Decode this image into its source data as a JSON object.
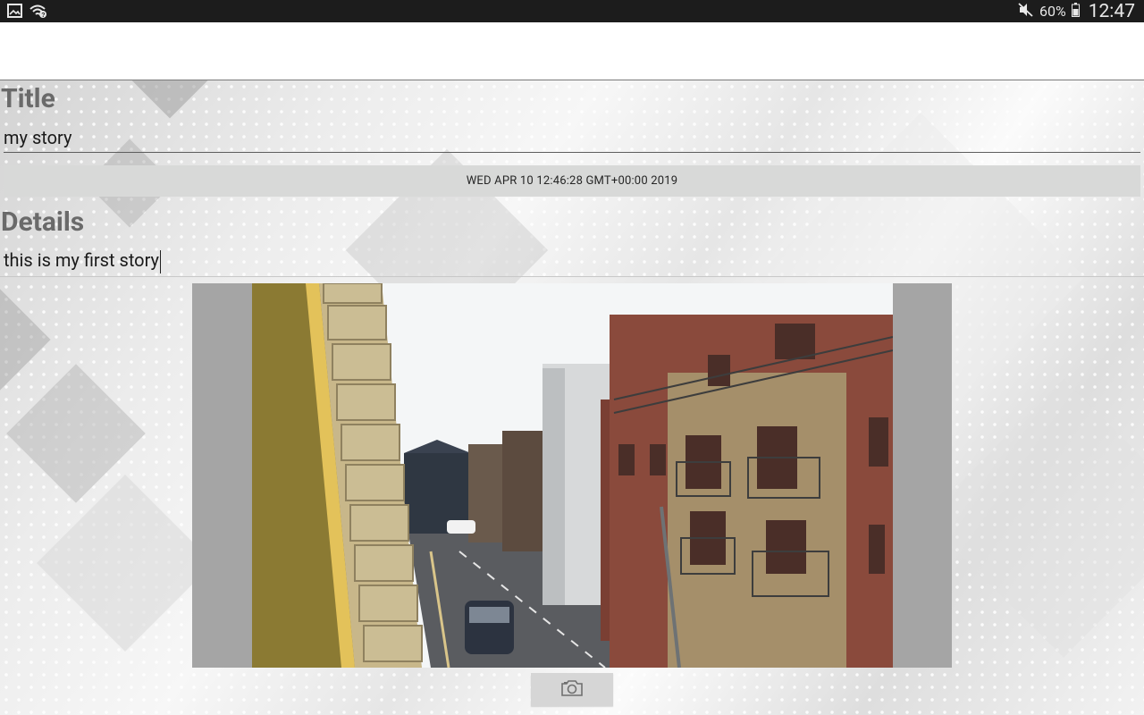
{
  "status_bar": {
    "icons_left": [
      "image-icon",
      "wifi-question-icon"
    ],
    "icons_right": [
      "mute-icon",
      "battery-icon"
    ],
    "battery": "60%",
    "time": "12:47"
  },
  "form": {
    "title_label": "Title",
    "title_value": "my story",
    "date_button": "WED APR 10 12:46:28 GMT+00:00 2019",
    "details_label": "Details",
    "details_value": "this is my first story"
  },
  "photo": {
    "icon": "camera-icon"
  }
}
